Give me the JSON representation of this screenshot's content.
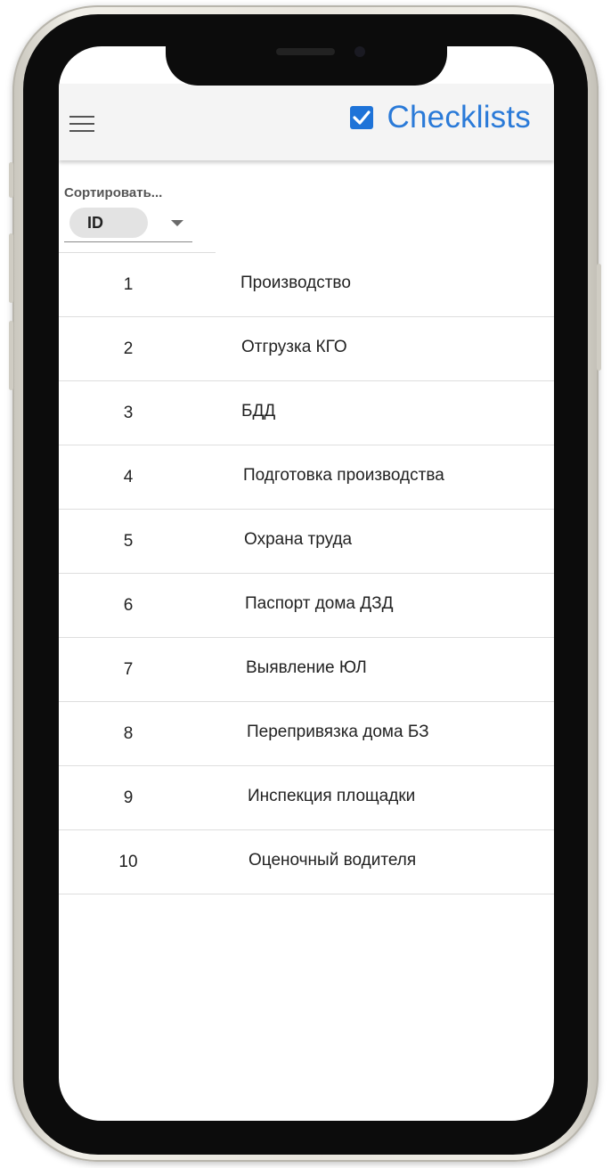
{
  "header": {
    "title": "Checklists",
    "menu_icon": "hamburger-menu-icon",
    "brand_icon": "checkbox-checked-icon",
    "brand_color": "#2a7ad8"
  },
  "sort": {
    "label": "Сортировать...",
    "value": "ID"
  },
  "checklists": [
    {
      "id": "1",
      "name": "Производство"
    },
    {
      "id": "2",
      "name": "Отгрузка КГО"
    },
    {
      "id": "3",
      "name": "БДД"
    },
    {
      "id": "4",
      "name": "Подготовка производства"
    },
    {
      "id": "5",
      "name": "Охрана труда"
    },
    {
      "id": "6",
      "name": "Паспорт дома ДЗД"
    },
    {
      "id": "7",
      "name": "Выявление ЮЛ"
    },
    {
      "id": "8",
      "name": "Перепривязка дома БЗ"
    },
    {
      "id": "9",
      "name": "Инспекция площадки"
    },
    {
      "id": "10",
      "name": "Оценочный водителя"
    }
  ]
}
